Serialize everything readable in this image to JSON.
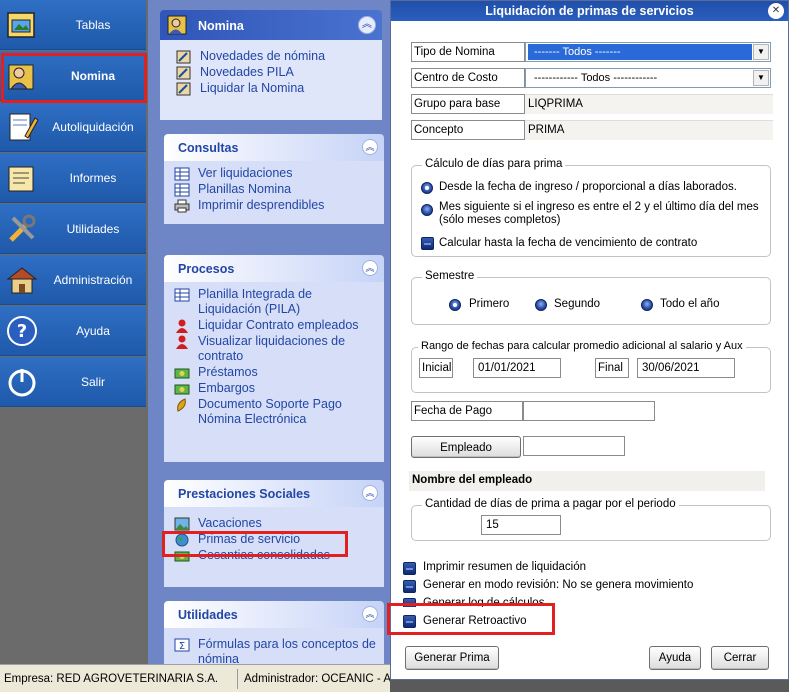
{
  "leftnav": {
    "items": [
      {
        "label": "Tablas",
        "icon": "tables-icon"
      },
      {
        "label": "Nomina",
        "icon": "payroll-user-icon",
        "active": true
      },
      {
        "label": "Autoliquidación",
        "icon": "notebook-pencil-icon"
      },
      {
        "label": "Informes",
        "icon": "report-icon"
      },
      {
        "label": "Utilidades",
        "icon": "tools-icon"
      },
      {
        "label": "Administración",
        "icon": "house-admin-icon"
      },
      {
        "label": "Ayuda",
        "icon": "help-icon"
      },
      {
        "label": "Salir",
        "icon": "power-icon"
      }
    ]
  },
  "nomina_panel": {
    "title": "Nomina",
    "items": [
      {
        "label": "Novedades de nómina",
        "icon": "edit-grid-icon"
      },
      {
        "label": "Novedades PILA",
        "icon": "edit-grid-icon"
      },
      {
        "label": "Liquidar la Nomina",
        "icon": "edit-grid-icon"
      }
    ]
  },
  "consultas": {
    "title": "Consultas",
    "items": [
      {
        "label": "Ver liquidaciones",
        "icon": "table-icon"
      },
      {
        "label": "Planillas Nomina",
        "icon": "table-icon"
      },
      {
        "label": "Imprimir desprendibles",
        "icon": "printer-icon"
      }
    ]
  },
  "procesos": {
    "title": "Procesos",
    "items": [
      {
        "label": "Planilla Integrada de Liquidación (PILA)",
        "icon": "table-icon"
      },
      {
        "label": "Liquidar Contrato empleados",
        "icon": "person-red-icon"
      },
      {
        "label": "Visualizar liquidaciones de contrato",
        "icon": "person-red-icon"
      },
      {
        "label": "Préstamos",
        "icon": "money-icon"
      },
      {
        "label": "Embargos",
        "icon": "money-icon"
      },
      {
        "label": "Documento Soporte Pago Nómina Electrónica",
        "icon": "leaf-icon"
      }
    ]
  },
  "prestaciones": {
    "title": "Prestaciones Sociales",
    "items": [
      {
        "label": "Vacaciones",
        "icon": "landscape-icon"
      },
      {
        "label": "Primas de servicio",
        "icon": "globe-icon"
      },
      {
        "label": "Cesantias consolidadas",
        "icon": "money-icon"
      }
    ]
  },
  "utilidades_panel": {
    "title": "Utilidades",
    "items": [
      {
        "label": "Fórmulas para los conceptos de nómina",
        "icon": "sigma-icon"
      }
    ]
  },
  "dialog": {
    "title": "Liquidación de primas de servicios",
    "fields": {
      "tipo_nomina": {
        "label": "Tipo de Nomina",
        "value": "------- Todos -------"
      },
      "centro_costo": {
        "label": "Centro de Costo",
        "value": "------------ Todos ------------"
      },
      "grupo_base": {
        "label": "Grupo para base",
        "value": "LIQPRIMA"
      },
      "concepto": {
        "label": "Concepto",
        "value": "PRIMA"
      }
    },
    "calculo": {
      "title": "Cálculo de días para prima",
      "options": [
        "Desde la fecha de ingreso / proporcional a días laborados.",
        "Mes siguiente si el ingreso es entre el 2 y el último día del mes (sólo meses completos)",
        "Calcular hasta la fecha de vencimiento de contrato"
      ]
    },
    "semestre": {
      "title": "Semestre",
      "options": [
        "Primero",
        "Segundo",
        "Todo el año"
      ]
    },
    "rango": {
      "title": "Rango de fechas para calcular promedio adicional al salario y Aux",
      "inicial_label": "Inicial",
      "inicial_value": "01/01/2021",
      "final_label": "Final",
      "final_value": "30/06/2021"
    },
    "fecha_pago_label": "Fecha de Pago",
    "fecha_pago_value": "",
    "empleado_button": "Empleado",
    "empleado_value": "",
    "nombre_empleado": "Nombre del empleado",
    "cantidad": {
      "title": "Cantidad de días de prima a pagar por el periodo",
      "value": "15"
    },
    "checks": [
      "Imprimir resumen de liquidación",
      "Generar en modo revisión: No se genera movimiento",
      "Generar log de cálculos",
      "Generar Retroactivo"
    ],
    "buttons": {
      "generar": "Generar Prima",
      "ayuda": "Ayuda",
      "cerrar": "Cerrar"
    }
  },
  "status": {
    "empresa": "Empresa: RED AGROVETERINARIA S.A.",
    "admin": "Administrador: OCEANIC - A"
  }
}
